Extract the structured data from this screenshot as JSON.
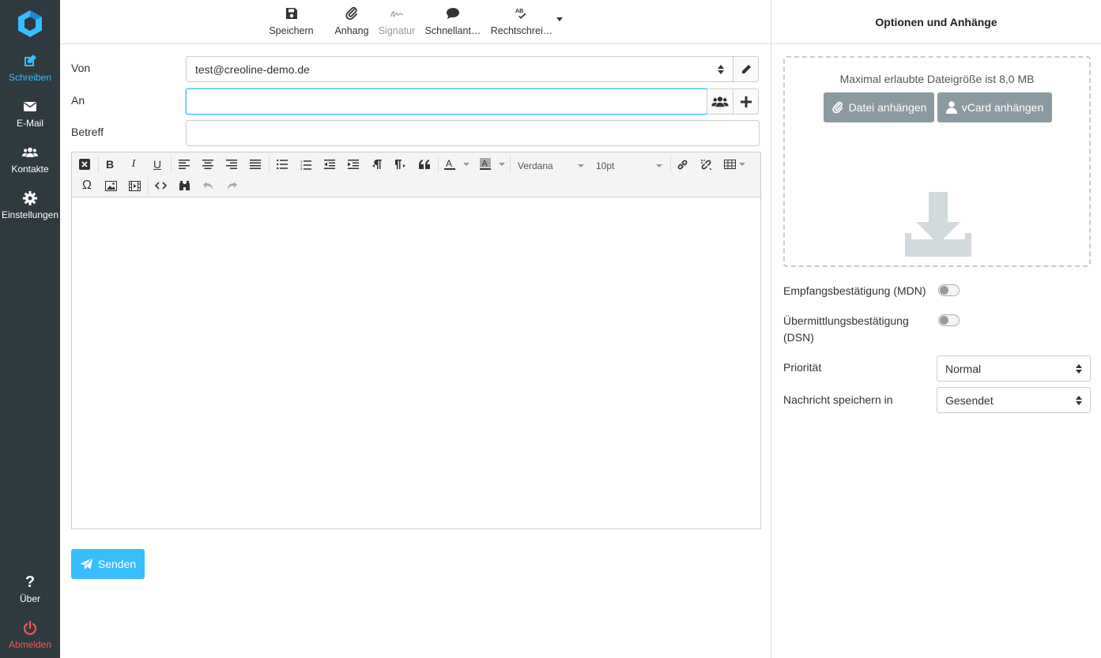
{
  "sidebar": {
    "items": [
      {
        "label": "Schreiben",
        "icon": "edit-icon"
      },
      {
        "label": "E-Mail",
        "icon": "envelope-icon"
      },
      {
        "label": "Kontakte",
        "icon": "users-icon"
      },
      {
        "label": "Einstellungen",
        "icon": "gear-icon"
      }
    ],
    "about_label": "Über",
    "logout_label": "Abmelden"
  },
  "toolbar": {
    "save": "Speichern",
    "attachment": "Anhang",
    "signature": "Signatur",
    "quick_responses": "Schnellant…",
    "spellcheck": "Rechtschrei…"
  },
  "form": {
    "from_label": "Von",
    "from_value": "test@creoline-demo.de",
    "to_label": "An",
    "to_value": "",
    "subject_label": "Betreff",
    "subject_value": ""
  },
  "editor": {
    "font_family": "Verdana",
    "font_size": "10pt"
  },
  "send_label": "Senden",
  "panel": {
    "title": "Optionen und Anhänge",
    "max_size_text": "Maximal erlaubte Dateigröße ist 8,0 MB",
    "attach_file_label": "Datei anhängen",
    "attach_vcard_label": "vCard anhängen",
    "mdn_label": "Empfangsbestätigung (MDN)",
    "dsn_label": "Übermittlungsbestätigung (DSN)",
    "priority_label": "Priorität",
    "priority_value": "Normal",
    "save_in_label": "Nachricht speichern in",
    "save_in_value": "Gesendet"
  },
  "colors": {
    "sidebar_bg": "#2f3a3f",
    "accent": "#37beff",
    "logout": "#ff5552",
    "attach_btn": "#8a9aa0"
  }
}
